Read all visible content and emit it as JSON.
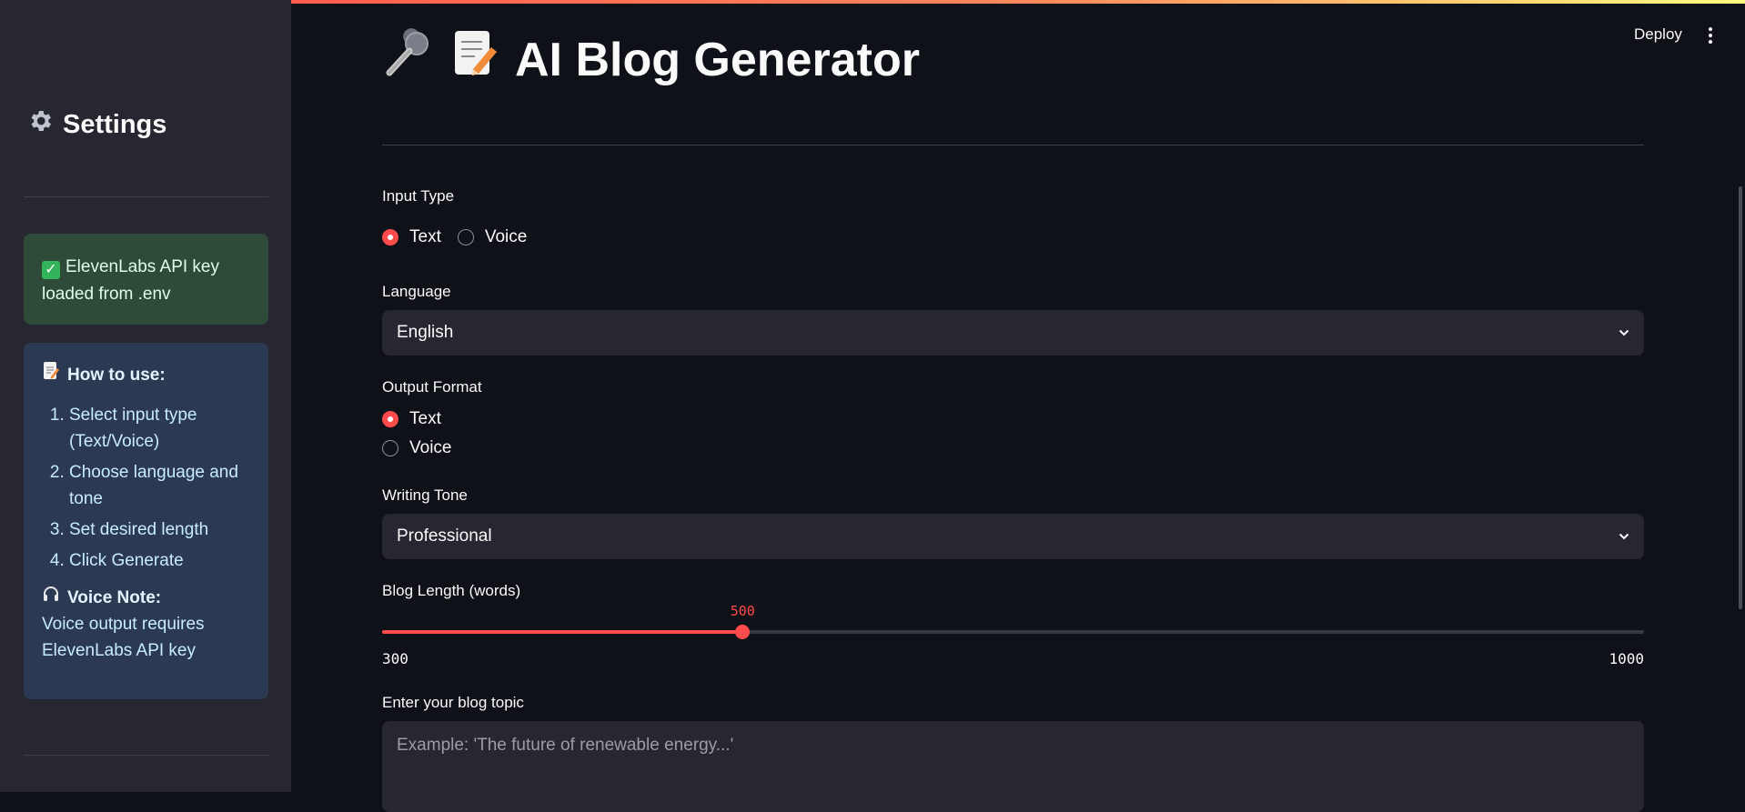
{
  "sidebar": {
    "title": "Settings",
    "success_text": "ElevenLabs API key loaded from .env",
    "howto_title": "How to use:",
    "steps": [
      "Select input type (Text/Voice)",
      "Choose language and tone",
      "Set desired length",
      "Click Generate"
    ],
    "voice_note_title": "Voice Note:",
    "voice_note_text": "Voice output requires ElevenLabs API key"
  },
  "header": {
    "deploy_label": "Deploy"
  },
  "main": {
    "title": "AI Blog Generator",
    "input_type": {
      "label": "Input Type",
      "options": [
        "Text",
        "Voice"
      ],
      "selected": "Text"
    },
    "language": {
      "label": "Language",
      "value": "English"
    },
    "output_format": {
      "label": "Output Format",
      "options": [
        "Text",
        "Voice"
      ],
      "selected": "Text"
    },
    "writing_tone": {
      "label": "Writing Tone",
      "value": "Professional"
    },
    "blog_length": {
      "label": "Blog Length (words)",
      "min": 300,
      "max": 1000,
      "value": 500
    },
    "topic": {
      "label": "Enter your blog topic",
      "placeholder": "Example: 'The future of renewable energy...'"
    }
  },
  "colors": {
    "accent": "#ff4b4b",
    "background": "#0e1117",
    "sidebar": "#262730",
    "success_bg": "#2e4a38",
    "info_bg": "#2b3a52"
  },
  "icons": [
    "gear-icon",
    "microphone-icon",
    "memo-icon",
    "check-icon",
    "headphone-icon",
    "chevron-down-icon",
    "kebab-menu-icon"
  ]
}
